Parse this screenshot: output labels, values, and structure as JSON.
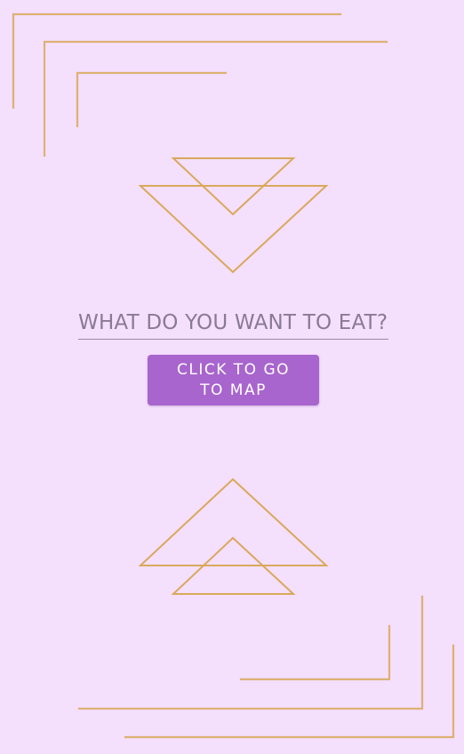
{
  "search": {
    "placeholder": "WHAT DO YOU WANT TO EAT?",
    "value": ""
  },
  "map_button": {
    "label": "CLICK TO GO TO MAP"
  },
  "colors": {
    "background": "#f4dffd",
    "gold_accent": "#d9a95b",
    "button": "#a865cd",
    "button_text": "#ffffff",
    "input_text": "#8a7a93"
  }
}
